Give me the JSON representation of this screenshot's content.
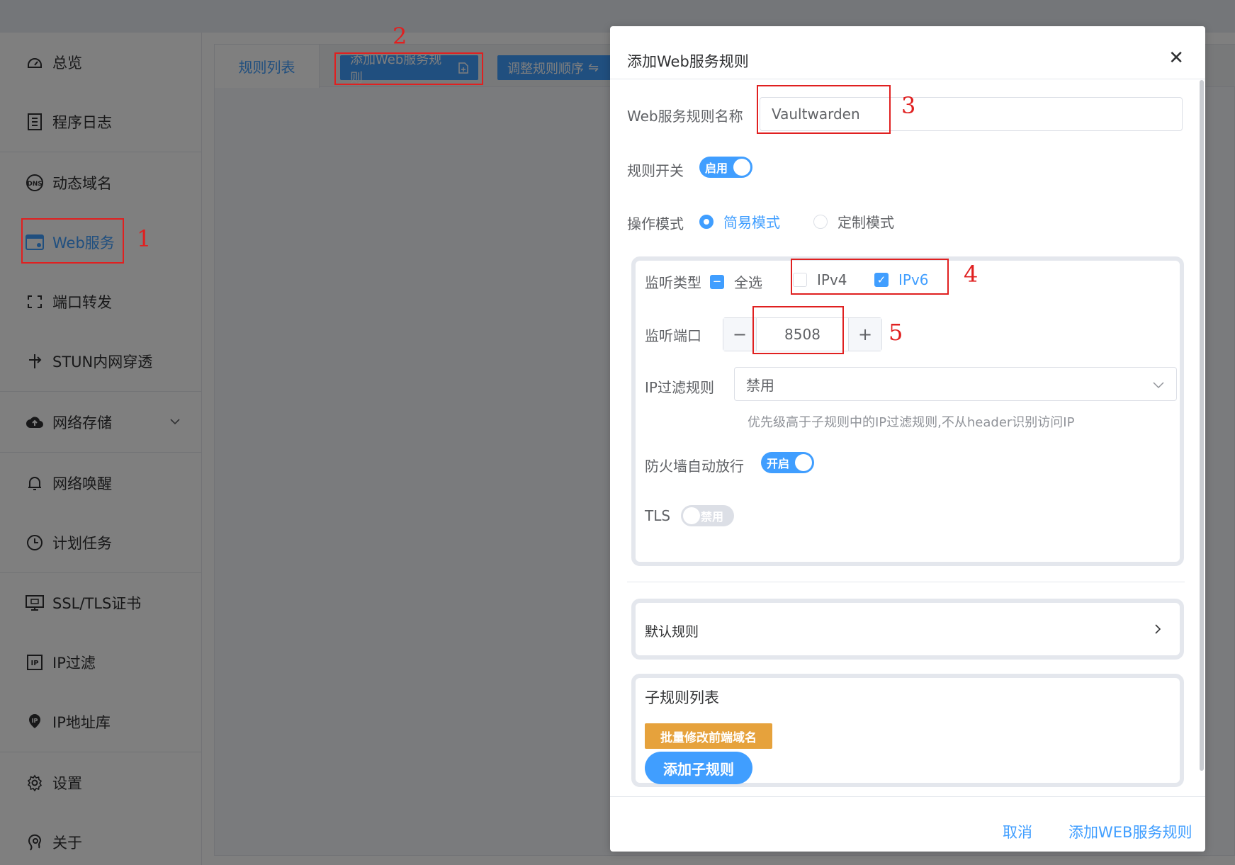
{
  "sidebar": {
    "items": [
      {
        "label": "总览",
        "icon": "dashboard-icon"
      },
      {
        "label": "程序日志",
        "icon": "log-icon"
      },
      {
        "label": "动态域名",
        "icon": "dns-icon"
      },
      {
        "label": "Web服务",
        "icon": "web-icon",
        "active": true
      },
      {
        "label": "端口转发",
        "icon": "port-forward-icon"
      },
      {
        "label": "STUN内网穿透",
        "icon": "stun-icon"
      },
      {
        "label": "网络存储",
        "icon": "cloud-storage-icon"
      },
      {
        "label": "网络唤醒",
        "icon": "bell-icon"
      },
      {
        "label": "计划任务",
        "icon": "clock-icon"
      },
      {
        "label": "SSL/TLS证书",
        "icon": "certificate-icon"
      },
      {
        "label": "IP过滤",
        "icon": "ip-filter-icon"
      },
      {
        "label": "IP地址库",
        "icon": "ip-database-icon"
      },
      {
        "label": "设置",
        "icon": "gear-icon"
      },
      {
        "label": "关于",
        "icon": "about-icon"
      }
    ]
  },
  "content": {
    "tab_label": "规则列表",
    "add_button": "添加Web服务规则",
    "order_button": "调整规则顺序"
  },
  "dialog": {
    "title": "添加Web服务规则",
    "close_glyph": "✕",
    "name_label": "Web服务规则名称",
    "name_value": "Vaultwarden",
    "switch_label": "规则开关",
    "switch_text": "启用",
    "mode_label": "操作模式",
    "mode_simple": "简易模式",
    "mode_custom": "定制模式",
    "listen_type_label": "监听类型",
    "select_all": "全选",
    "ipv4": "IPv4",
    "ipv6": "IPv6",
    "port_label": "监听端口",
    "port_value": "8508",
    "ip_filter_label": "IP过滤规则",
    "ip_filter_value": "禁用",
    "ip_filter_hint": "优先级高于子规则中的IP过滤规则,不从header识别访问IP",
    "firewall_label": "防火墙自动放行",
    "firewall_text": "开启",
    "tls_label": "TLS",
    "tls_text": "禁用",
    "default_rule": "默认规则",
    "subrules_title": "子规则列表",
    "batch_button": "批量修改前端域名",
    "add_subrule_button": "添加子规则",
    "cancel_button": "取消",
    "confirm_button": "添加WEB服务规则"
  },
  "annotations": [
    "1",
    "2",
    "3",
    "4",
    "5"
  ],
  "colors": {
    "accent": "#409eff",
    "warning": "#e6a23c",
    "annotation": "#e02020"
  }
}
